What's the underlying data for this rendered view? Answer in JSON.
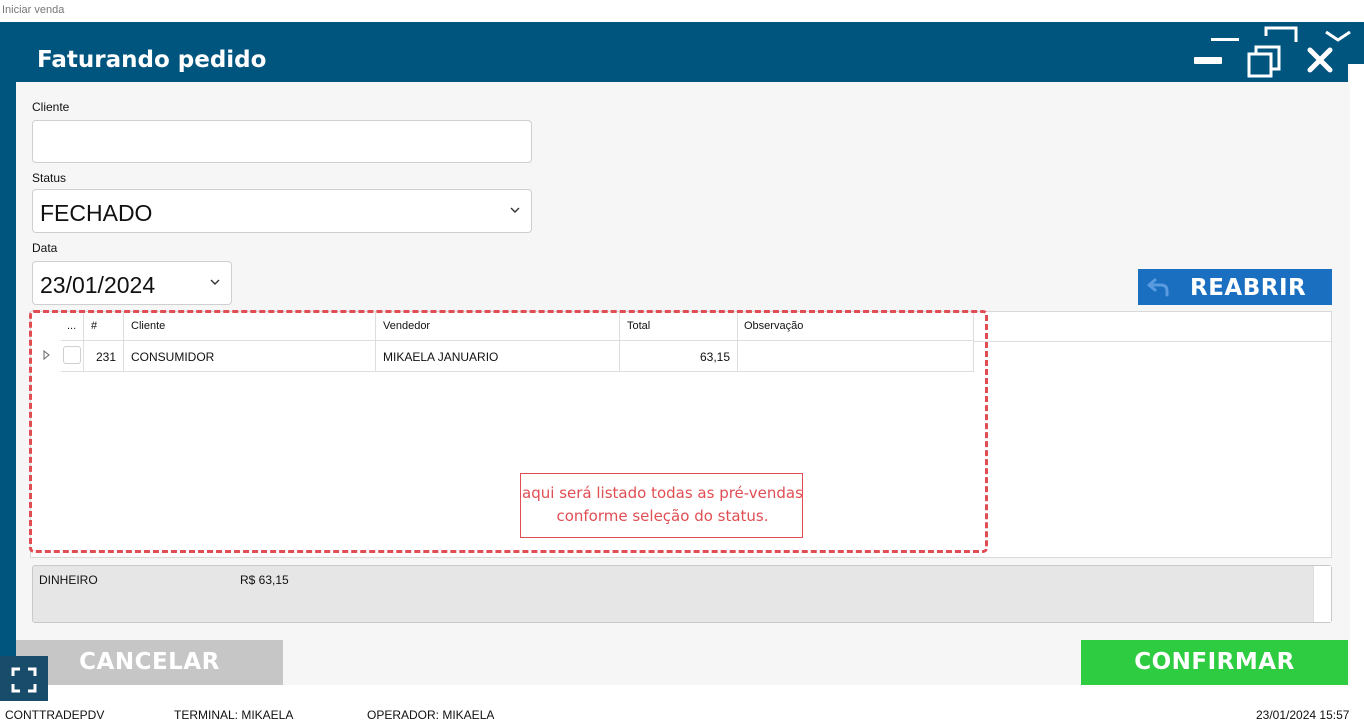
{
  "background_window": {
    "title": "Iniciar venda"
  },
  "dialog": {
    "title": "Faturando pedido"
  },
  "form": {
    "cliente_label": "Cliente",
    "cliente_value": "",
    "status_label": "Status",
    "status_value": "FECHADO",
    "data_label": "Data",
    "data_value": "23/01/2024"
  },
  "reabrir_label": "REABRIR",
  "grid": {
    "columns": [
      "...",
      "#",
      "Cliente",
      "Vendedor",
      "Total",
      "Observação"
    ],
    "rows": [
      {
        "checked": false,
        "id": "231",
        "cliente": "CONSUMIDOR",
        "vendedor": "MIKAELA JANUARIO",
        "total": "63,15",
        "observacao": ""
      }
    ]
  },
  "annotation": {
    "line1": "aqui será listado todas as pré-vendas",
    "line2": "conforme  seleção do status."
  },
  "payment": {
    "method": "DINHEIRO",
    "value": "R$ 63,15"
  },
  "buttons": {
    "cancel": "CANCELAR",
    "confirm": "CONFIRMAR"
  },
  "statusbar": {
    "app": "CONTTRADEPDV",
    "terminal": "TERMINAL: MIKAELA",
    "operator": "OPERADOR: MIKAELA",
    "datetime": "23/01/2024 15:57"
  },
  "colors": {
    "header": "#00557f",
    "reabrir": "#1a6fc0",
    "confirm": "#2ecc40",
    "cancel": "#c6c6c6",
    "annotation": "#e04e53"
  }
}
